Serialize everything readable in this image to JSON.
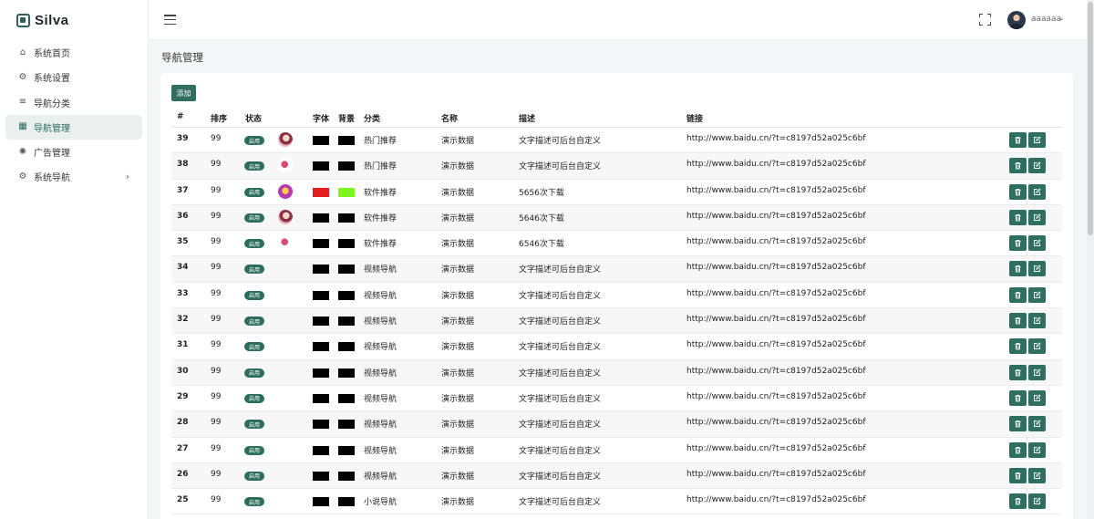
{
  "app": {
    "logo_text": "Silva"
  },
  "sidebar": {
    "items": [
      {
        "label": "系统首页",
        "icon": "home-icon",
        "active": false
      },
      {
        "label": "系统设置",
        "icon": "gear-icon",
        "active": false
      },
      {
        "label": "导航分类",
        "icon": "list-icon",
        "active": false
      },
      {
        "label": "导航管理",
        "icon": "grid-icon",
        "active": true
      },
      {
        "label": "广告管理",
        "icon": "loader-icon",
        "active": false
      },
      {
        "label": "系统导航",
        "icon": "gear-icon",
        "active": false,
        "has_children": true
      }
    ]
  },
  "header": {
    "username": "aaaaaa"
  },
  "page": {
    "title": "导航管理",
    "add_label": "添加"
  },
  "table": {
    "columns": [
      "#",
      "排序",
      "状态",
      "字体",
      "背景",
      "分类",
      "名称",
      "描述",
      "链接"
    ],
    "rows": [
      {
        "id": "39",
        "sort": "99",
        "status": "启用",
        "img": "a",
        "font": "#000000",
        "bg": "#000000",
        "category": "热门推荐",
        "name": "演示数据",
        "desc": "文字描述可后台自定义",
        "link": "http://www.baidu.cn/?t=c8197d52a025c6bf"
      },
      {
        "id": "38",
        "sort": "99",
        "status": "启用",
        "img": "b",
        "font": "#000000",
        "bg": "#000000",
        "category": "热门推荐",
        "name": "演示数据",
        "desc": "文字描述可后台自定义",
        "link": "http://www.baidu.cn/?t=c8197d52a025c6bf"
      },
      {
        "id": "37",
        "sort": "99",
        "status": "启用",
        "img": "c",
        "font": "#e11d1d",
        "bg": "#7ef51e",
        "category": "软件推荐",
        "name": "演示数据",
        "desc": "5656次下载",
        "link": "http://www.baidu.cn/?t=c8197d52a025c6bf"
      },
      {
        "id": "36",
        "sort": "99",
        "status": "启用",
        "img": "a",
        "font": "#000000",
        "bg": "#000000",
        "category": "软件推荐",
        "name": "演示数据",
        "desc": "5646次下载",
        "link": "http://www.baidu.cn/?t=c8197d52a025c6bf"
      },
      {
        "id": "35",
        "sort": "99",
        "status": "启用",
        "img": "b",
        "font": "#000000",
        "bg": "#000000",
        "category": "软件推荐",
        "name": "演示数据",
        "desc": "6546次下载",
        "link": "http://www.baidu.cn/?t=c8197d52a025c6bf"
      },
      {
        "id": "34",
        "sort": "99",
        "status": "启用",
        "img": "",
        "font": "#000000",
        "bg": "#000000",
        "category": "视频导航",
        "name": "演示数据",
        "desc": "文字描述可后台自定义",
        "link": "http://www.baidu.cn/?t=c8197d52a025c6bf"
      },
      {
        "id": "33",
        "sort": "99",
        "status": "启用",
        "img": "",
        "font": "#000000",
        "bg": "#000000",
        "category": "视频导航",
        "name": "演示数据",
        "desc": "文字描述可后台自定义",
        "link": "http://www.baidu.cn/?t=c8197d52a025c6bf"
      },
      {
        "id": "32",
        "sort": "99",
        "status": "启用",
        "img": "",
        "font": "#000000",
        "bg": "#000000",
        "category": "视频导航",
        "name": "演示数据",
        "desc": "文字描述可后台自定义",
        "link": "http://www.baidu.cn/?t=c8197d52a025c6bf"
      },
      {
        "id": "31",
        "sort": "99",
        "status": "启用",
        "img": "",
        "font": "#000000",
        "bg": "#000000",
        "category": "视频导航",
        "name": "演示数据",
        "desc": "文字描述可后台自定义",
        "link": "http://www.baidu.cn/?t=c8197d52a025c6bf"
      },
      {
        "id": "30",
        "sort": "99",
        "status": "启用",
        "img": "",
        "font": "#000000",
        "bg": "#000000",
        "category": "视频导航",
        "name": "演示数据",
        "desc": "文字描述可后台自定义",
        "link": "http://www.baidu.cn/?t=c8197d52a025c6bf"
      },
      {
        "id": "29",
        "sort": "99",
        "status": "启用",
        "img": "",
        "font": "#000000",
        "bg": "#000000",
        "category": "视频导航",
        "name": "演示数据",
        "desc": "文字描述可后台自定义",
        "link": "http://www.baidu.cn/?t=c8197d52a025c6bf"
      },
      {
        "id": "28",
        "sort": "99",
        "status": "启用",
        "img": "",
        "font": "#000000",
        "bg": "#000000",
        "category": "视频导航",
        "name": "演示数据",
        "desc": "文字描述可后台自定义",
        "link": "http://www.baidu.cn/?t=c8197d52a025c6bf"
      },
      {
        "id": "27",
        "sort": "99",
        "status": "启用",
        "img": "",
        "font": "#000000",
        "bg": "#000000",
        "category": "视频导航",
        "name": "演示数据",
        "desc": "文字描述可后台自定义",
        "link": "http://www.baidu.cn/?t=c8197d52a025c6bf"
      },
      {
        "id": "26",
        "sort": "99",
        "status": "启用",
        "img": "",
        "font": "#000000",
        "bg": "#000000",
        "category": "视频导航",
        "name": "演示数据",
        "desc": "文字描述可后台自定义",
        "link": "http://www.baidu.cn/?t=c8197d52a025c6bf"
      },
      {
        "id": "25",
        "sort": "99",
        "status": "启用",
        "img": "",
        "font": "#000000",
        "bg": "#000000",
        "category": "小说导航",
        "name": "演示数据",
        "desc": "文字描述可后台自定义",
        "link": "http://www.baidu.cn/?t=c8197d52a025c6bf"
      }
    ]
  },
  "colors": {
    "accent": "#2f6f5f",
    "active_bg": "#e9f0ee"
  }
}
